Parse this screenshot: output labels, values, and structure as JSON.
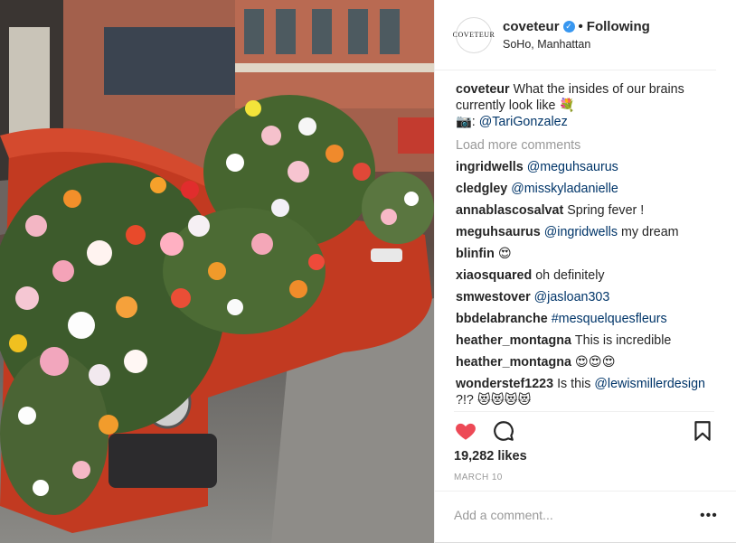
{
  "header": {
    "avatar_text": "COVETEUR",
    "username": "coveteur",
    "verified_icon": "verified-badge-icon",
    "separator": "•",
    "follow_state": "Following",
    "location": "SoHo, Manhattan"
  },
  "caption": {
    "username": "coveteur",
    "text": "What the insides of our brains currently look like 💐",
    "credit_prefix": "📷:",
    "credit_handle": "@TariGonzalez"
  },
  "load_more": "Load more comments",
  "comments": [
    {
      "user": "ingridwells",
      "text": "",
      "mention": "@meguhsaurus"
    },
    {
      "user": "cledgley",
      "text": "",
      "mention": "@misskyladanielle"
    },
    {
      "user": "annablascosalvat",
      "text": "Spring fever !",
      "mention": ""
    },
    {
      "user": "meguhsaurus",
      "text": "my dream",
      "mention": "@ingridwells"
    },
    {
      "user": "blinfin",
      "text": "😍",
      "mention": ""
    },
    {
      "user": "xiaosquared",
      "text": "oh definitely",
      "mention": ""
    },
    {
      "user": "smwestover",
      "text": "",
      "mention": "@jasloan303"
    },
    {
      "user": "bbdelabranche",
      "text": "",
      "mention": "#mesquelquesfleurs"
    },
    {
      "user": "heather_montagna",
      "text": "This is incredible",
      "mention": ""
    },
    {
      "user": "heather_montagna",
      "text": "😍😍😍",
      "mention": ""
    },
    {
      "user": "wonderstef1223",
      "text": "Is this",
      "mention": "@lewismillerdesign",
      "after": "?!? 😻😻😻😻"
    }
  ],
  "actions": {
    "like_icon": "heart-filled-icon",
    "comment_icon": "comment-icon",
    "save_icon": "bookmark-icon"
  },
  "likes": "19,282 likes",
  "date": "MARCH 10",
  "add_comment_placeholder": "Add a comment...",
  "more_options": "•••",
  "colors": {
    "accent_link": "#003569",
    "verified": "#3897f0",
    "heart": "#ed4956",
    "muted": "#999999"
  }
}
